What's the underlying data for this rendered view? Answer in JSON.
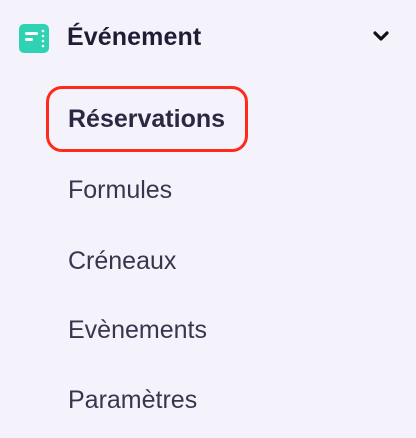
{
  "section": {
    "title": "Événement",
    "icon": "event-calendar-icon",
    "accent_color": "#2fd3b3",
    "expanded": true
  },
  "nav": {
    "items": [
      {
        "label": "Réservations",
        "active": true
      },
      {
        "label": "Formules",
        "active": false
      },
      {
        "label": "Créneaux",
        "active": false
      },
      {
        "label": "Evènements",
        "active": false
      },
      {
        "label": "Paramètres",
        "active": false
      }
    ]
  },
  "highlight_color": "#ff2a1a"
}
